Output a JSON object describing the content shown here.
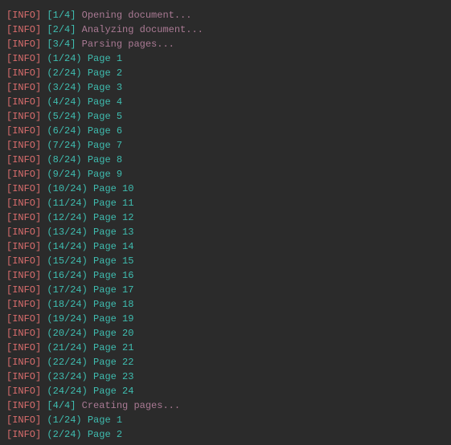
{
  "tag_label": "[INFO]",
  "lines": [
    {
      "kind": "step",
      "step": "[1/4]",
      "msg": "Opening document..."
    },
    {
      "kind": "step",
      "step": "[2/4]",
      "msg": "Analyzing document..."
    },
    {
      "kind": "step",
      "step": "[3/4]",
      "msg": "Parsing pages..."
    },
    {
      "kind": "page",
      "counter": "(1/24)",
      "page": "Page 1"
    },
    {
      "kind": "page",
      "counter": "(2/24)",
      "page": "Page 2"
    },
    {
      "kind": "page",
      "counter": "(3/24)",
      "page": "Page 3"
    },
    {
      "kind": "page",
      "counter": "(4/24)",
      "page": "Page 4"
    },
    {
      "kind": "page",
      "counter": "(5/24)",
      "page": "Page 5"
    },
    {
      "kind": "page",
      "counter": "(6/24)",
      "page": "Page 6"
    },
    {
      "kind": "page",
      "counter": "(7/24)",
      "page": "Page 7"
    },
    {
      "kind": "page",
      "counter": "(8/24)",
      "page": "Page 8"
    },
    {
      "kind": "page",
      "counter": "(9/24)",
      "page": "Page 9"
    },
    {
      "kind": "page",
      "counter": "(10/24)",
      "page": "Page 10"
    },
    {
      "kind": "page",
      "counter": "(11/24)",
      "page": "Page 11"
    },
    {
      "kind": "page",
      "counter": "(12/24)",
      "page": "Page 12"
    },
    {
      "kind": "page",
      "counter": "(13/24)",
      "page": "Page 13"
    },
    {
      "kind": "page",
      "counter": "(14/24)",
      "page": "Page 14"
    },
    {
      "kind": "page",
      "counter": "(15/24)",
      "page": "Page 15"
    },
    {
      "kind": "page",
      "counter": "(16/24)",
      "page": "Page 16"
    },
    {
      "kind": "page",
      "counter": "(17/24)",
      "page": "Page 17"
    },
    {
      "kind": "page",
      "counter": "(18/24)",
      "page": "Page 18"
    },
    {
      "kind": "page",
      "counter": "(19/24)",
      "page": "Page 19"
    },
    {
      "kind": "page",
      "counter": "(20/24)",
      "page": "Page 20"
    },
    {
      "kind": "page",
      "counter": "(21/24)",
      "page": "Page 21"
    },
    {
      "kind": "page",
      "counter": "(22/24)",
      "page": "Page 22"
    },
    {
      "kind": "page",
      "counter": "(23/24)",
      "page": "Page 23"
    },
    {
      "kind": "page",
      "counter": "(24/24)",
      "page": "Page 24"
    },
    {
      "kind": "step",
      "step": "[4/4]",
      "msg": "Creating pages..."
    },
    {
      "kind": "page",
      "counter": "(1/24)",
      "page": "Page 1"
    },
    {
      "kind": "page",
      "counter": "(2/24)",
      "page": "Page 2"
    }
  ]
}
